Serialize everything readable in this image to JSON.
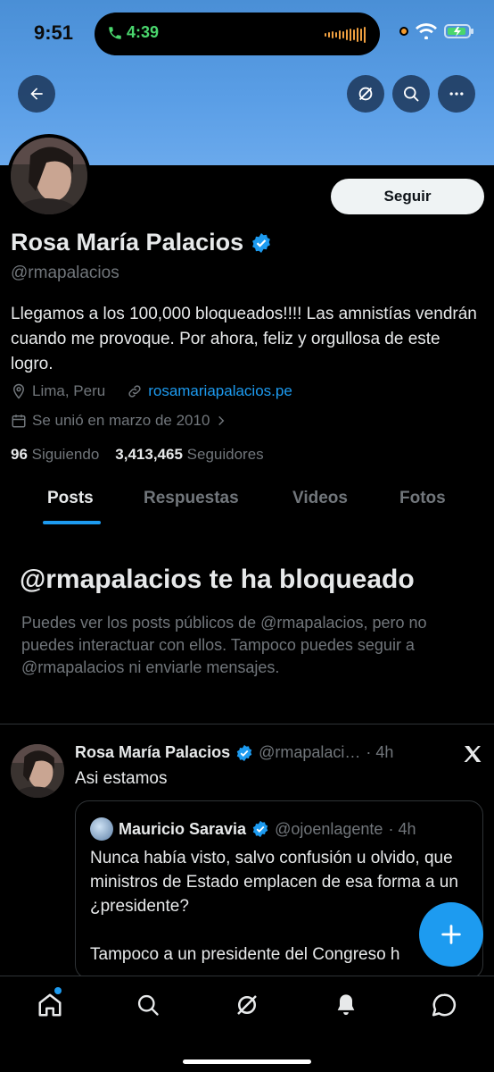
{
  "status_bar": {
    "time": "9:51",
    "call_timer": "4:39"
  },
  "profile": {
    "name": "Rosa María Palacios",
    "handle": "@rmapalacios",
    "bio": "Llegamos a los 100,000 bloqueados!!!! Las amnistías vendrán cuando me provoque. Por ahora, feliz y orgullosa de este logro.",
    "location": "Lima, Peru",
    "website": "rosamariapalacios.pe",
    "joined": "Se unió en marzo de 2010",
    "following_count": "96",
    "following_label": "Siguiendo",
    "followers_count": "3,413,465",
    "followers_label": "Seguidores",
    "follow_button": "Seguir"
  },
  "tabs": [
    {
      "label": "Posts",
      "active": true
    },
    {
      "label": "Respuestas",
      "active": false
    },
    {
      "label": "Videos",
      "active": false
    },
    {
      "label": "Fotos",
      "active": false
    }
  ],
  "blocked": {
    "title": "@rmapalacios te ha bloqueado",
    "description": "Puedes ver los posts públicos de @rmapalacios, pero no puedes interactuar con ellos. Tampoco puedes seguir a @rmapalacios ni enviarle mensajes."
  },
  "post": {
    "author": "Rosa María Palacios",
    "handle": "@rmapalaci…",
    "time": "· 4h",
    "text": "Asi estamos",
    "quote": {
      "author": "Mauricio Saravia",
      "handle": "@ojoenlagente",
      "time": "· 4h",
      "text_line1": "Nunca había visto, salvo confusión u olvido, que ministros de Estado emplacen de esa forma a un ¿presidente?",
      "text_line2": "Tampoco a un presidente del Congreso h"
    }
  },
  "colors": {
    "accent": "#1d9bf0",
    "banner": "#5a9ee6",
    "background": "#000000",
    "muted": "#71767b"
  },
  "icons": [
    "back-arrow-icon",
    "grok-icon",
    "search-icon",
    "more-icon",
    "verified-badge-icon",
    "location-icon",
    "link-icon",
    "calendar-icon",
    "x-logo-icon",
    "compose-plus-icon",
    "home-icon",
    "explore-icon",
    "grok-nav-icon",
    "notifications-icon",
    "messages-icon"
  ]
}
